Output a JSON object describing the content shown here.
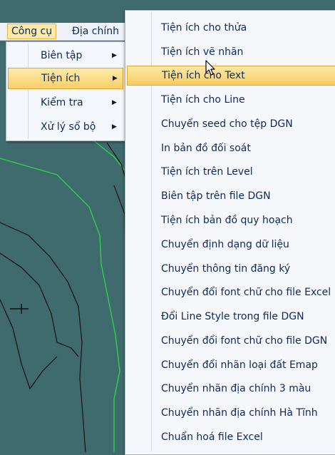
{
  "menubar": {
    "items": [
      {
        "label": "Công cụ"
      },
      {
        "label": "Địa chính"
      }
    ]
  },
  "submenu_cong_cu": {
    "items": [
      {
        "label": "Biên tập"
      },
      {
        "label": "Tiện ích"
      },
      {
        "label": "Kiểm tra"
      },
      {
        "label": "Xử lý sổ bộ"
      }
    ]
  },
  "submenu_tien_ich": {
    "items": [
      {
        "label": "Tiện ích cho thửa"
      },
      {
        "label": "Tiện ích vẽ nhãn"
      },
      {
        "label": "Tiện ích cho Text"
      },
      {
        "label": "Tiện ích cho Line"
      },
      {
        "label": "Chuyển seed cho tệp DGN"
      },
      {
        "label": "In bản đồ đối soát"
      },
      {
        "label": "Tiện ích trên Level"
      },
      {
        "label": "Biên tập trên file DGN"
      },
      {
        "label": "Tiện ích bản đồ quy hoạch"
      },
      {
        "label": "Chuyển định dạng dữ liệu"
      },
      {
        "label": "Chuyển thông tin đăng ký"
      },
      {
        "label": "Chuyển đổi font chữ cho file Excel"
      },
      {
        "label": "Đổi Line Style trong file DGN"
      },
      {
        "label": "Chuyển đổi font chữ cho file DGN"
      },
      {
        "label": "Chuyển đổi nhãn loại đất Emap"
      },
      {
        "label": "Chuyển nhãn địa chính 3 màu"
      },
      {
        "label": "Chuyển nhãn địa chính Hà Tĩnh"
      },
      {
        "label": "Chuẩn hoá file Excel"
      }
    ]
  },
  "icons": {
    "submenu_arrow": "chevron-right-icon",
    "cursor": "mouse-pointer-icon"
  },
  "colors": {
    "map_background": "#3f6a6e",
    "highlight": "#f8cf6a",
    "menu_text": "#0b2a5a",
    "parcel_line_green": "#2fd24a"
  }
}
